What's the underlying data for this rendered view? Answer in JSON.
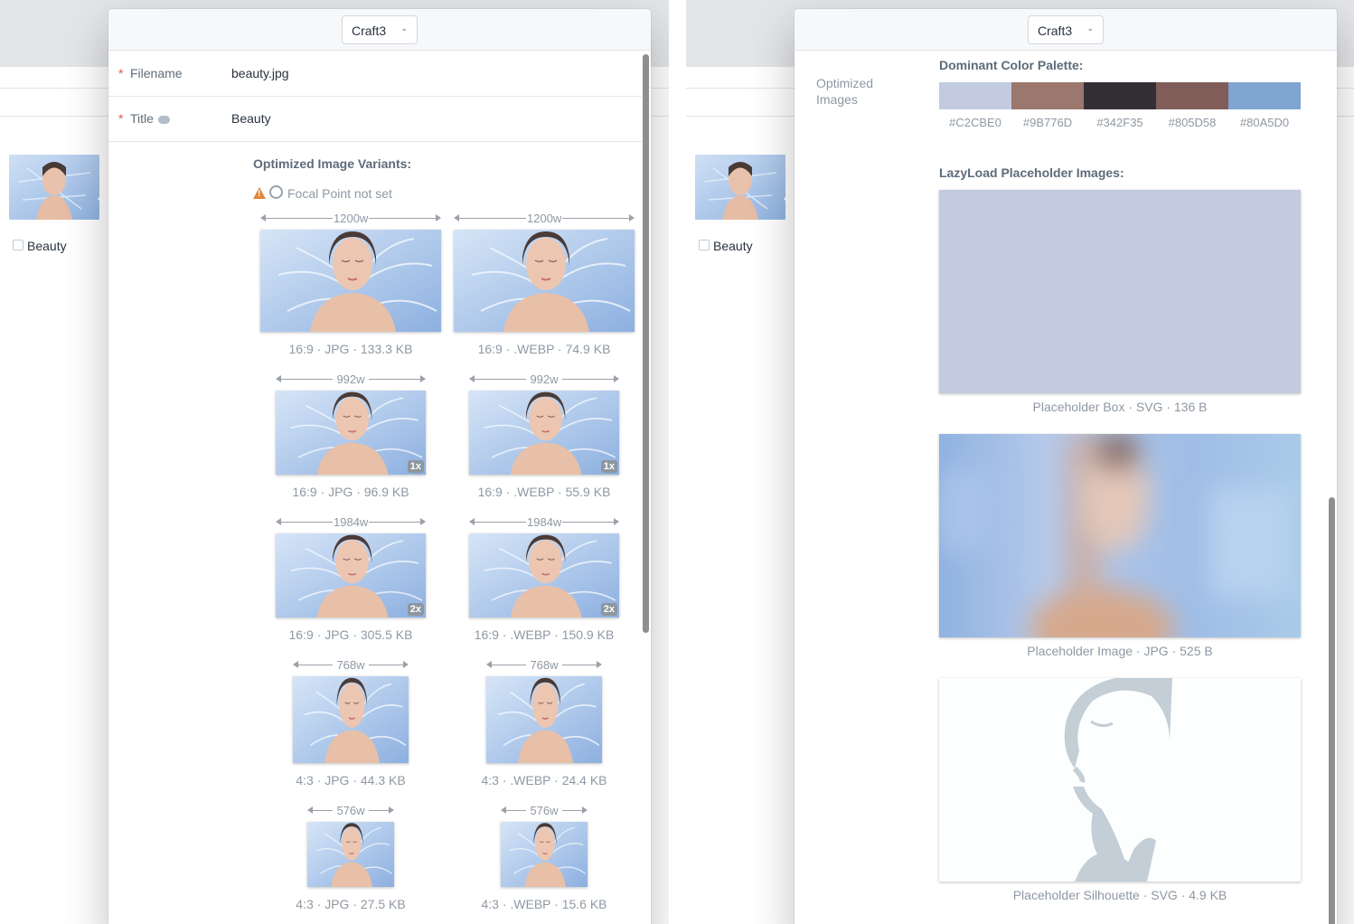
{
  "site_select": {
    "value": "Craft3"
  },
  "fields": {
    "filename": {
      "label": "Filename",
      "value": "beauty.jpg"
    },
    "title": {
      "label": "Title",
      "value": "Beauty"
    }
  },
  "asset": {
    "checkbox_label": "Beauty"
  },
  "variants_section": {
    "title": "Optimized Image Variants:",
    "focal_warning": "Focal Point not set"
  },
  "variants": [
    {
      "width": "1200w",
      "caption": "16:9 · JPG · 133.3 KB",
      "badge": ""
    },
    {
      "width": "1200w",
      "caption": "16:9 · .WEBP · 74.9 KB",
      "badge": ""
    },
    {
      "width": "992w",
      "caption": "16:9 · JPG · 96.9 KB",
      "badge": "1x"
    },
    {
      "width": "992w",
      "caption": "16:9 · .WEBP · 55.9 KB",
      "badge": "1x"
    },
    {
      "width": "1984w",
      "caption": "16:9 · JPG · 305.5 KB",
      "badge": "2x"
    },
    {
      "width": "1984w",
      "caption": "16:9 · .WEBP · 150.9 KB",
      "badge": "2x"
    },
    {
      "width": "768w",
      "caption": "4:3 · JPG · 44.3 KB",
      "badge": ""
    },
    {
      "width": "768w",
      "caption": "4:3 · .WEBP · 24.4 KB",
      "badge": ""
    },
    {
      "width": "576w",
      "caption": "4:3 · JPG · 27.5 KB",
      "badge": ""
    },
    {
      "width": "576w",
      "caption": "4:3 · .WEBP · 15.6 KB",
      "badge": ""
    }
  ],
  "right_panel": {
    "side_label": "Optimized Images",
    "palette_title": "Dominant Color Palette:",
    "palette": [
      {
        "hex": "#C2CBE0"
      },
      {
        "hex": "#9B776D"
      },
      {
        "hex": "#342F35"
      },
      {
        "hex": "#805D58"
      },
      {
        "hex": "#80A5D0"
      }
    ],
    "lazyload_title": "LazyLoad Placeholder Images:",
    "placeholders": [
      {
        "caption": "Placeholder Box · SVG · 136 B"
      },
      {
        "caption": "Placeholder Image · JPG · 525 B"
      },
      {
        "caption": "Placeholder Silhouette · SVG · 4.9 KB"
      }
    ]
  },
  "colors": {
    "required": "#da5a47",
    "warning": "#e1853a",
    "muted_text": "#8f98a3"
  }
}
